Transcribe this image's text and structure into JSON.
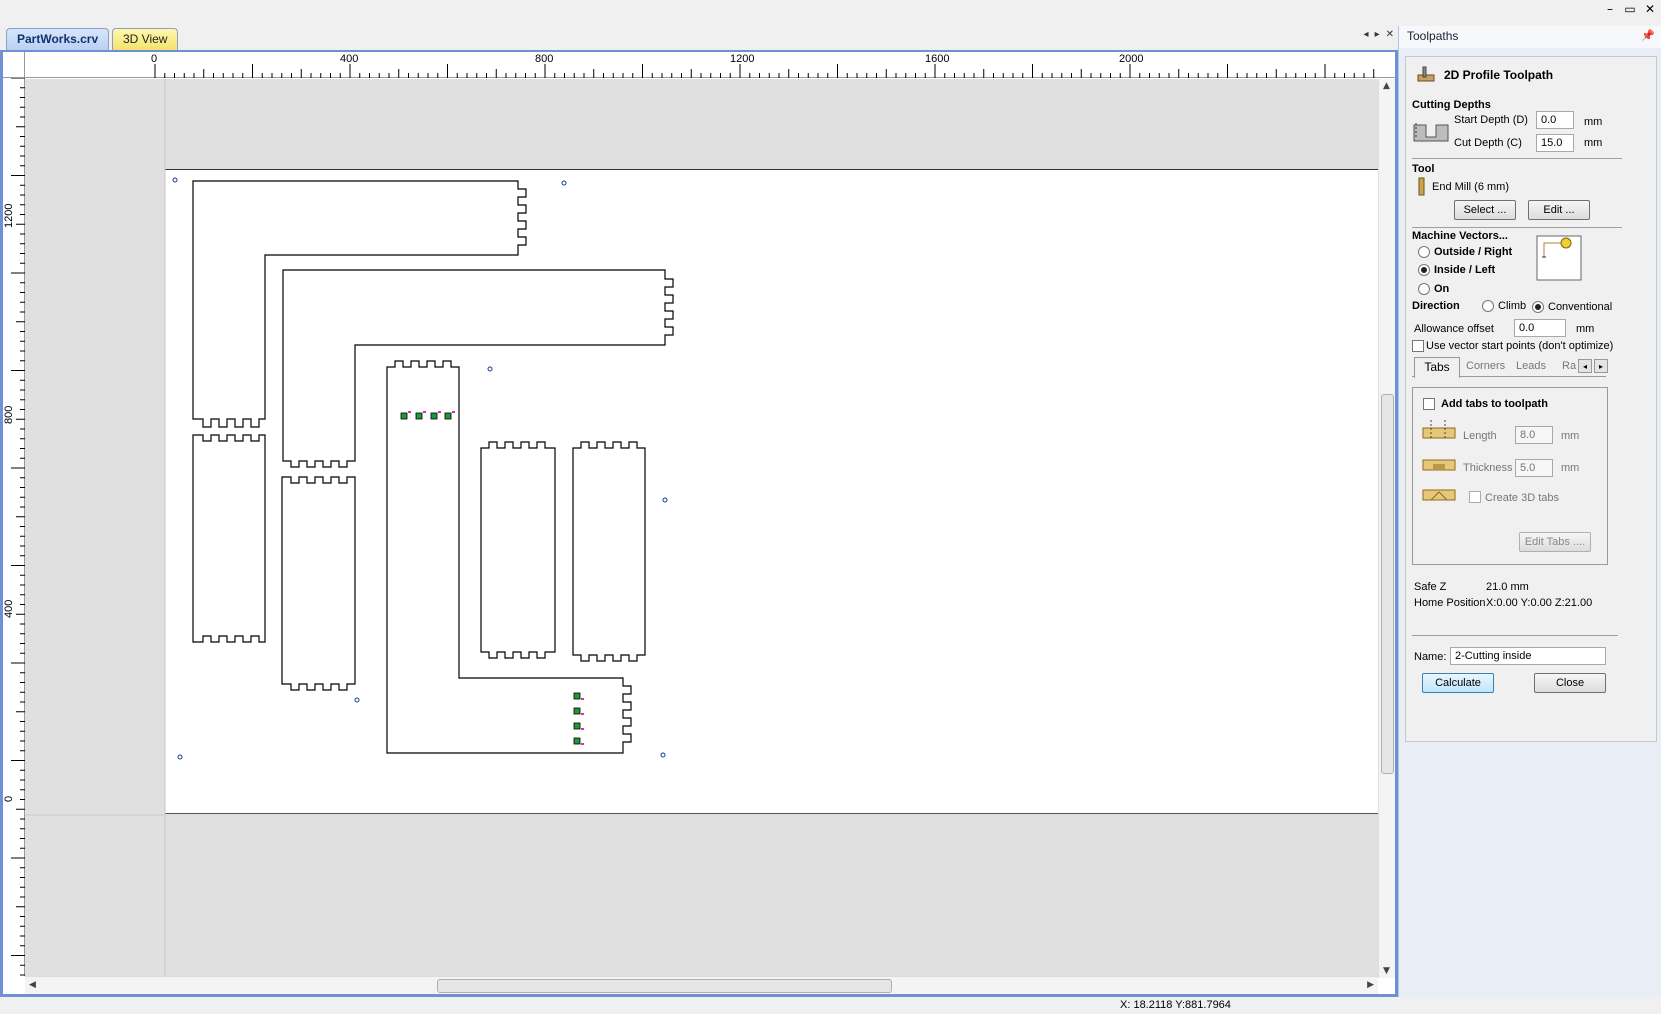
{
  "window": {
    "controls": [
      "–",
      "▭",
      "✕"
    ]
  },
  "doc_tabs": [
    {
      "label": "PartWorks.crv",
      "active": true
    },
    {
      "label": "3D View",
      "active": false
    }
  ],
  "tab_nav": [
    "◂",
    "▸",
    "✕"
  ],
  "rulers": {
    "top_labels": [
      "0",
      "400",
      "800",
      "1200",
      "1600",
      "2000"
    ],
    "left_labels": [
      "1200",
      "800",
      "400",
      "0"
    ]
  },
  "status": {
    "coords": "X: 18.2118 Y:881.7964"
  },
  "panel": {
    "title": "Toolpaths",
    "pin_icon": "pin-icon",
    "toolpath_title": "2D Profile Toolpath",
    "cutting_depths": {
      "heading": "Cutting Depths",
      "start_label": "Start Depth (D)",
      "start_value": "0.0",
      "cut_label": "Cut Depth (C)",
      "cut_value": "15.0",
      "unit": "mm"
    },
    "tool": {
      "heading": "Tool",
      "name": "End Mill (6 mm)",
      "select_label": "Select ...",
      "edit_label": "Edit ..."
    },
    "machine_vectors": {
      "heading": "Machine Vectors...",
      "options": [
        "Outside / Right",
        "Inside / Left",
        "On"
      ],
      "selected": "Inside / Left"
    },
    "direction": {
      "heading": "Direction",
      "options": [
        "Climb",
        "Conventional"
      ],
      "selected": "Conventional"
    },
    "allowance": {
      "label": "Allowance offset",
      "value": "0.0",
      "unit": "mm"
    },
    "use_vector_start": "Use vector start points (don't optimize)",
    "subtabs": [
      "Tabs",
      "Corners",
      "Leads",
      "Ra"
    ],
    "tabs": {
      "add_label": "Add tabs to toolpath",
      "length_label": "Length",
      "length_value": "8.0",
      "thickness_label": "Thickness",
      "thickness_value": "5.0",
      "unit": "mm",
      "create3d_label": "Create 3D tabs",
      "edit_tabs_label": "Edit Tabs ...."
    },
    "safe_z_label": "Safe Z",
    "safe_z_value": "21.0 mm",
    "home_label": "Home Position",
    "home_value": "X:0.00 Y:0.00 Z:21.00",
    "name_label": "Name:",
    "name_value": "2-Cutting inside",
    "calculate_label": "Calculate",
    "close_label": "Close"
  }
}
